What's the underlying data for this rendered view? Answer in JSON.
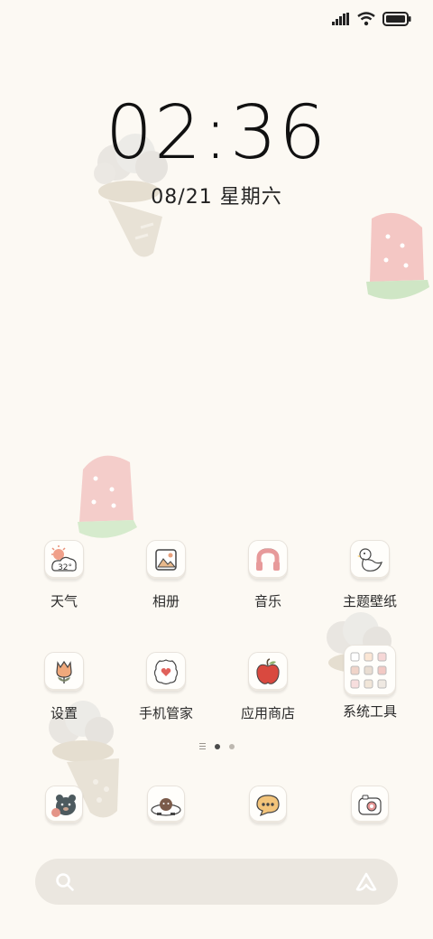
{
  "status_bar": {
    "signal_icon": "signal-icon",
    "wifi_icon": "wifi-icon",
    "battery_icon": "battery-icon"
  },
  "lockclock": {
    "time": "02:36",
    "date": "08/21 星期六"
  },
  "apps": [
    {
      "name": "天气",
      "icon": "weather-icon",
      "temp": "32°"
    },
    {
      "name": "相册",
      "icon": "gallery-icon"
    },
    {
      "name": "音乐",
      "icon": "music-icon"
    },
    {
      "name": "主题壁纸",
      "icon": "themes-icon"
    },
    {
      "name": "设置",
      "icon": "settings-icon"
    },
    {
      "name": "手机管家",
      "icon": "security-icon"
    },
    {
      "name": "应用商店",
      "icon": "app-store-icon"
    },
    {
      "name": "系统工具",
      "icon": "system-tools-folder-icon"
    }
  ],
  "page_indicator": {
    "pages": 2,
    "current": 1
  },
  "dock": [
    {
      "icon": "phone-icon"
    },
    {
      "icon": "contacts-icon"
    },
    {
      "icon": "messages-icon"
    },
    {
      "icon": "camera-icon"
    }
  ],
  "search": {
    "search_icon": "search-icon",
    "assistant_icon": "assistant-icon"
  },
  "colors": {
    "background": "#fcf9f3",
    "watermelon": "#f2b6b4",
    "rind": "#c9e2bd",
    "icecream": "#e7e1d6"
  }
}
